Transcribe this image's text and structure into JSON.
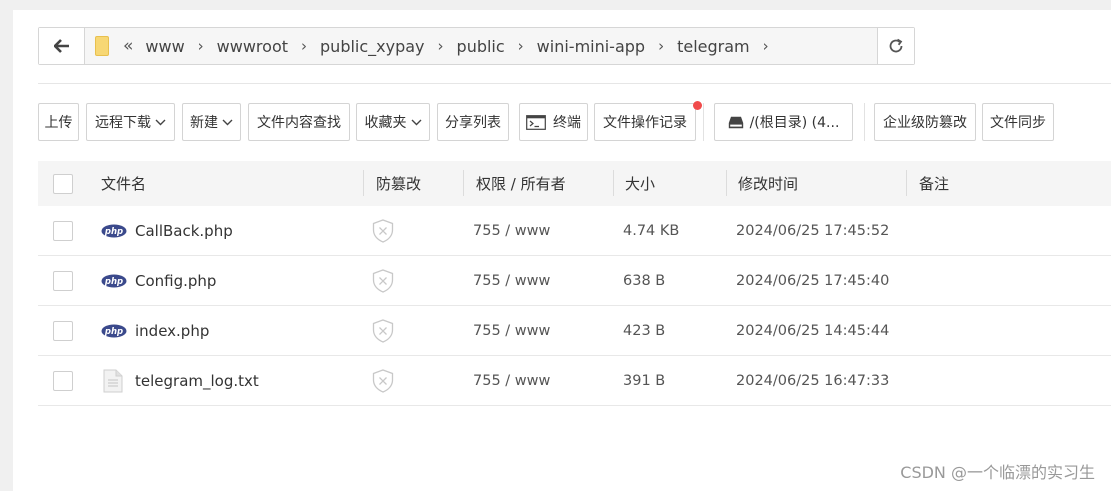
{
  "breadcrumb": {
    "items": [
      "www",
      "wwwroot",
      "public_xypay",
      "public",
      "wini-mini-app",
      "telegram"
    ]
  },
  "toolbar": {
    "upload": "上传",
    "remote_download": "远程下载",
    "new": "新建",
    "content_search": "文件内容查找",
    "favorites": "收藏夹",
    "share_list": "分享列表",
    "terminal": "终端",
    "operation_log": "文件操作记录",
    "disk": "/(根目录) (4...",
    "tamper_proof": "企业级防篡改",
    "file_sync": "文件同步"
  },
  "table": {
    "headers": {
      "name": "文件名",
      "tamper": "防篡改",
      "perm": "权限 / 所有者",
      "size": "大小",
      "mtime": "修改时间",
      "note": "备注"
    },
    "rows": [
      {
        "name": "CallBack.php",
        "icon": "php-icon",
        "perm": "755 / www",
        "size": "4.74 KB",
        "mtime": "2024/06/25 17:45:52"
      },
      {
        "name": "Config.php",
        "icon": "php-icon",
        "perm": "755 / www",
        "size": "638 B",
        "mtime": "2024/06/25 17:45:40"
      },
      {
        "name": "index.php",
        "icon": "php-icon",
        "perm": "755 / www",
        "size": "423 B",
        "mtime": "2024/06/25 14:45:44"
      },
      {
        "name": "telegram_log.txt",
        "icon": "text-file-icon",
        "perm": "755 / www",
        "size": "391 B",
        "mtime": "2024/06/25 16:47:33"
      }
    ]
  },
  "watermark": "CSDN @一个临漂的实习生",
  "colors": {
    "accent_red": "#f14b4b",
    "php_badge": "#3b4a8c"
  }
}
